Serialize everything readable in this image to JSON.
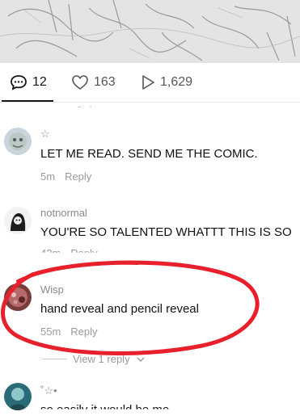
{
  "stats": {
    "comments": "12",
    "likes": "163",
    "views": "1,629"
  },
  "comments": [
    {
      "username": "☆",
      "text": "LET ME READ. SEND ME THE COMIC.",
      "time": "5m",
      "reply": "Reply"
    },
    {
      "username": "notnormal",
      "text": "YOU'RE SO TALENTED WHATTT THIS IS SO",
      "time": "42m",
      "reply": "Reply"
    },
    {
      "username": "Wisp",
      "text": "hand reveal and pencil reveal",
      "time": "55m",
      "reply": "Reply",
      "view_replies": "View 1 reply"
    },
    {
      "username": "˚☆•",
      "text": "so easily it would be me"
    }
  ],
  "colors": {
    "annotation_circle": "#e8202b"
  }
}
